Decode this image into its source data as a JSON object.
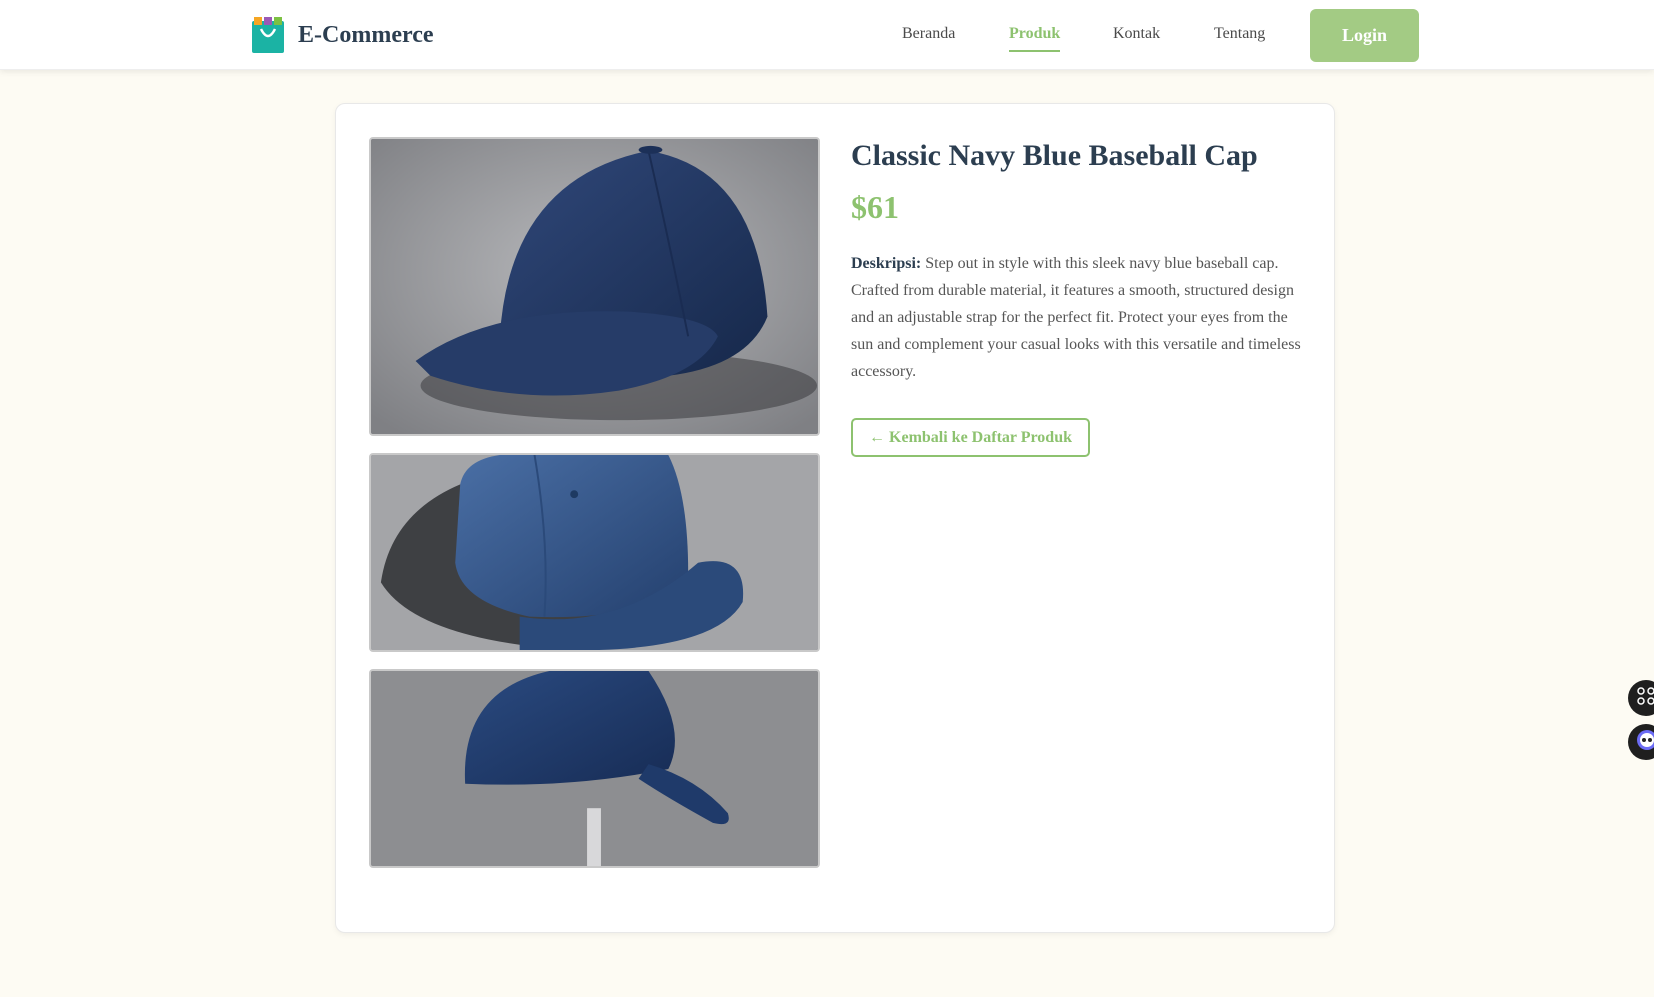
{
  "header": {
    "brand_name": "E-Commerce",
    "nav": [
      {
        "label": "Beranda"
      },
      {
        "label": "Produk",
        "active": true
      },
      {
        "label": "Kontak"
      },
      {
        "label": "Tentang"
      }
    ],
    "login_label": "Login"
  },
  "product": {
    "title": "Classic Navy Blue Baseball Cap",
    "price": "$61",
    "description_label": "Deskripsi:",
    "description": "Step out in style with this sleek navy blue baseball cap. Crafted from durable material, it features a smooth, structured design and an adjustable strap for the perfect fit. Protect your eyes from the sun and complement your casual looks with this versatile and timeless accessory.",
    "back_label": "← Kembali ke Daftar Produk",
    "images": [
      "cap-photo-front",
      "cap-photo-side",
      "cap-photo-angle"
    ]
  },
  "widgets": [
    "grid-icon",
    "assistant-icon"
  ],
  "colors": {
    "accent": "#8dc26f",
    "login_bg": "#a3cb84",
    "page_bg": "#fdfbf3",
    "title": "#2c3e50",
    "cap_navy": "#1f3560"
  }
}
